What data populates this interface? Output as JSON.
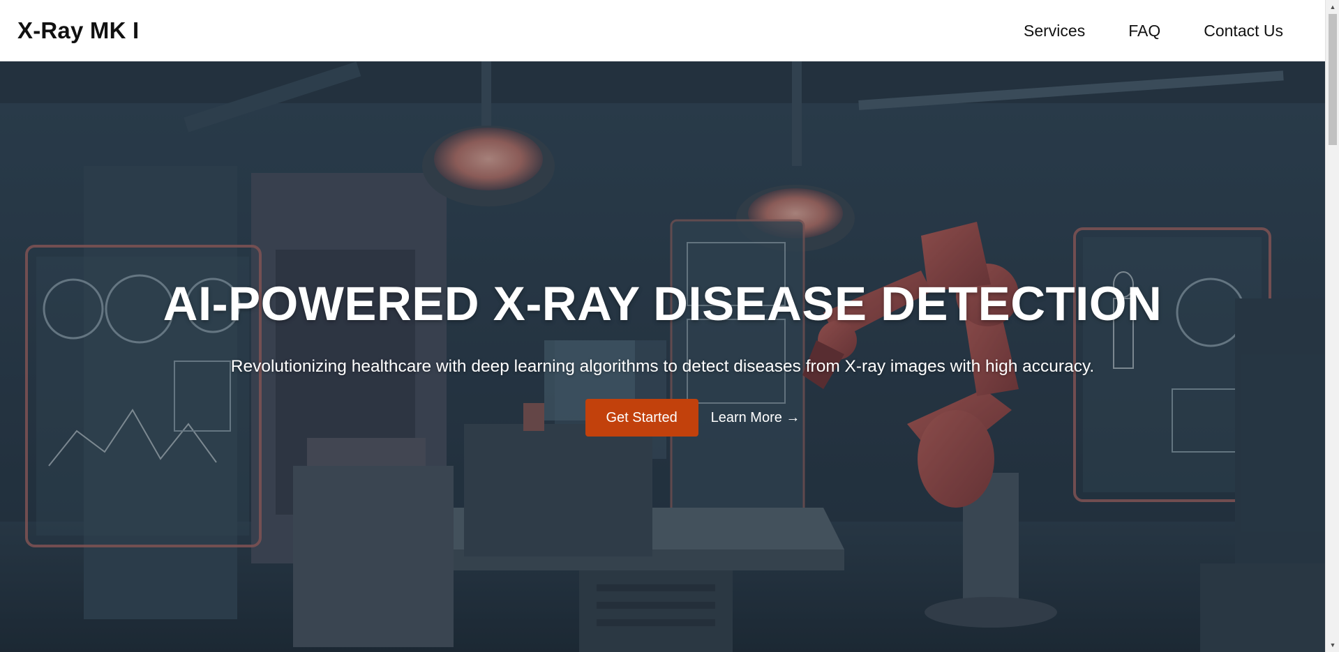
{
  "navbar": {
    "brand": "X-Ray MK I",
    "links": [
      {
        "label": "Services"
      },
      {
        "label": "FAQ"
      },
      {
        "label": "Contact Us"
      }
    ]
  },
  "hero": {
    "title": "AI-POWERED X-RAY DISEASE DETECTION",
    "subtitle": "Revolutionizing healthcare with deep learning algorithms to detect diseases from X-ray images with high accuracy.",
    "primary_button": "Get Started",
    "secondary_link": "Learn More →"
  },
  "colors": {
    "accent": "#c2410c",
    "hero_tint": "#2b3c4a",
    "navbar_bg": "#ffffff",
    "text_dark": "#111111"
  },
  "icons": {
    "scroll_up": "triangle-up-icon",
    "scroll_down": "triangle-down-icon"
  }
}
